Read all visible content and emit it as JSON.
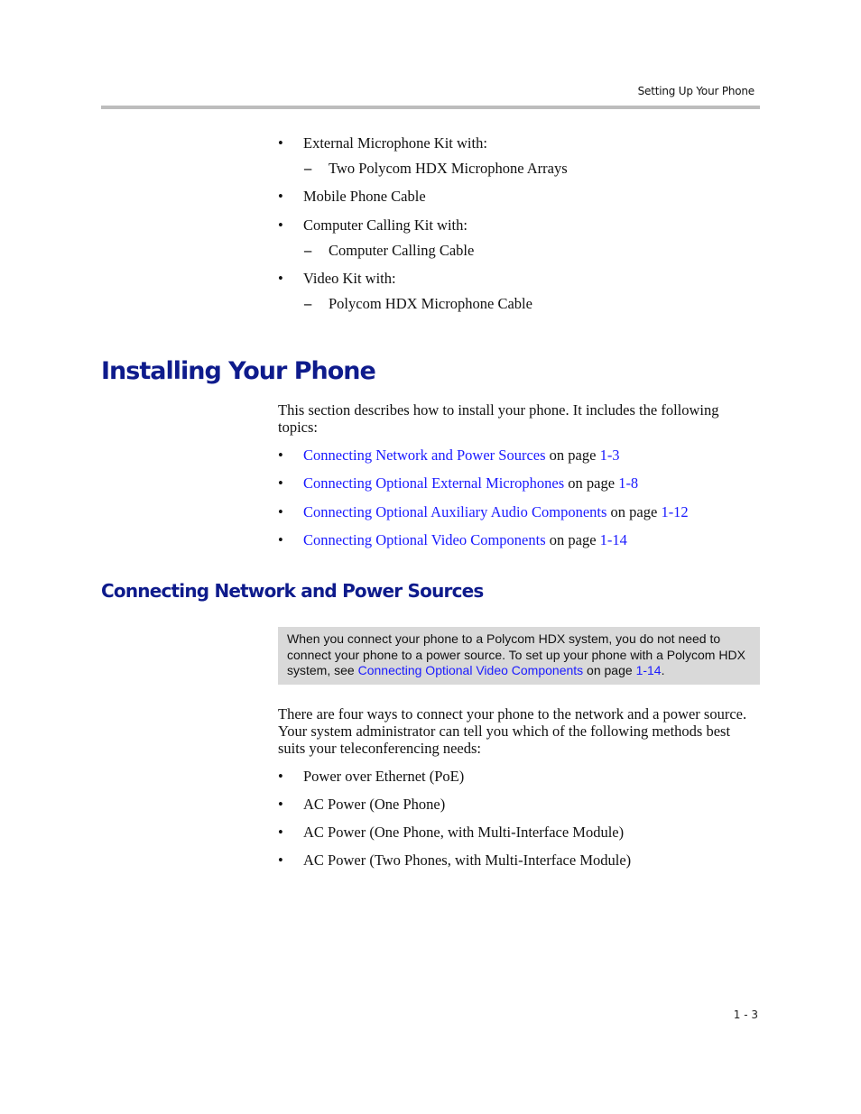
{
  "header": {
    "running_title": "Setting Up Your Phone"
  },
  "kit_list": [
    {
      "label": "External Microphone Kit with:",
      "sub": [
        "Two Polycom HDX Microphone Arrays"
      ]
    },
    {
      "label": "Mobile Phone Cable",
      "sub": []
    },
    {
      "label": "Computer Calling Kit with:",
      "sub": [
        "Computer Calling Cable"
      ]
    },
    {
      "label": "Video Kit with:",
      "sub": [
        "Polycom HDX Microphone Cable"
      ]
    }
  ],
  "bullet_glyph": "•",
  "dash_glyph": "–",
  "section1": {
    "heading": "Installing Your Phone",
    "intro": "This section describes how to install your phone. It includes the following topics:",
    "topics": [
      {
        "link": "Connecting Network and Power Sources",
        "on_page": " on page ",
        "page": "1-3"
      },
      {
        "link": "Connecting Optional External Microphones",
        "on_page": " on page ",
        "page": "1-8"
      },
      {
        "link": "Connecting Optional Auxiliary Audio Components",
        "on_page": " on page ",
        "page": "1-12"
      },
      {
        "link": "Connecting Optional Video Components",
        "on_page": " on page ",
        "page": "1-14"
      }
    ]
  },
  "section2": {
    "heading": "Connecting Network and Power Sources",
    "note": {
      "text_before": "When you connect your phone to a Polycom HDX system, you do not need to connect your phone to a power source. To set up your phone with a Polycom HDX system, see ",
      "link": "Connecting Optional Video Components",
      "on_page": " on page ",
      "page": "1-14",
      "end": "."
    },
    "body": "There are four ways to connect your phone to the network and a power source. Your system administrator can tell you which of the following methods best suits your teleconferencing needs:",
    "methods": [
      "Power over Ethernet (PoE)",
      "AC Power (One Phone)",
      "AC Power (One Phone, with Multi-Interface Module)",
      "AC Power (Two Phones, with Multi-Interface Module)"
    ]
  },
  "footer": {
    "page_number": "1 - 3"
  },
  "colors": {
    "heading": "#0e1b8c",
    "link": "#1a1aff",
    "note_bg": "#d9d9d9",
    "rule": "#bdbdbd"
  }
}
